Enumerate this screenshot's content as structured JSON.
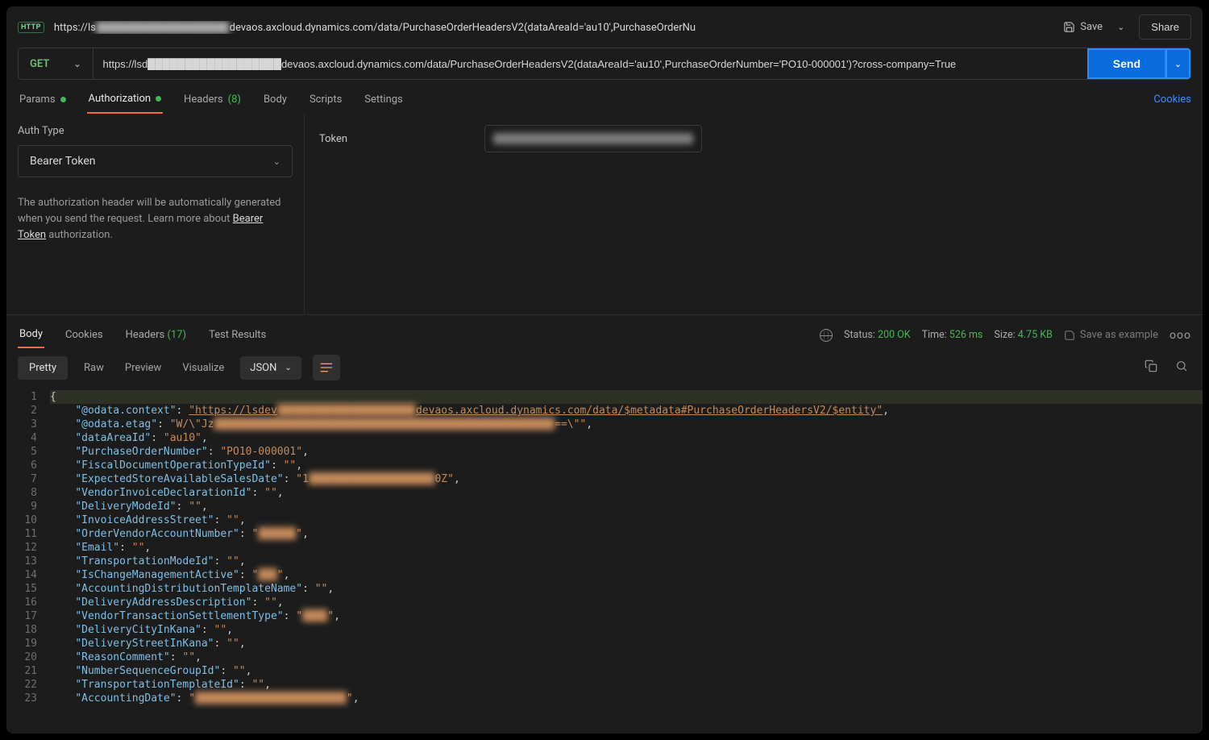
{
  "header": {
    "http_badge": "HTTP",
    "title_prefix": "https://ls",
    "title_blur": "██████████████████",
    "title_suffix": "devaos.axcloud.dynamics.com/data/PurchaseOrderHeadersV2(dataAreaId='au10',PurchaseOrderNu",
    "save_label": "Save",
    "share_label": "Share"
  },
  "request": {
    "method": "GET",
    "url": "https://lsd██████████████████devaos.axcloud.dynamics.com/data/PurchaseOrderHeadersV2(dataAreaId='au10',PurchaseOrderNumber='PO10-000001')?cross-company=True",
    "send_label": "Send"
  },
  "req_tabs": {
    "params": "Params",
    "authorization": "Authorization",
    "headers": "Headers",
    "headers_count": "(8)",
    "body": "Body",
    "scripts": "Scripts",
    "settings": "Settings",
    "cookies": "Cookies"
  },
  "auth": {
    "type_label": "Auth Type",
    "type_value": "Bearer Token",
    "help_1": "The authorization header will be automatically generated when you send the request. Learn more about ",
    "help_link": "Bearer Token",
    "help_2": " authorization.",
    "token_label": "Token"
  },
  "res_tabs": {
    "body": "Body",
    "cookies": "Cookies",
    "headers": "Headers",
    "headers_count": "(17)",
    "test_results": "Test Results"
  },
  "res_meta": {
    "status_label": "Status:",
    "status_value": "200 OK",
    "time_label": "Time:",
    "time_value": "526 ms",
    "size_label": "Size:",
    "size_value": "4.75 KB",
    "save_example": "Save as example"
  },
  "view": {
    "pretty": "Pretty",
    "raw": "Raw",
    "preview": "Preview",
    "visualize": "Visualize",
    "json": "JSON"
  },
  "response_body": {
    "lines": [
      {
        "raw": "{"
      },
      {
        "indent": 2,
        "key": "@odata.context",
        "value_prefix": "https://lsdev",
        "value_blur": "██████████████████████",
        "value_suffix": "devaos.axcloud.dynamics.com/data/$metadata#PurchaseOrderHeadersV2/$entity",
        "url": true,
        "comma": true
      },
      {
        "indent": 2,
        "key": "@odata.etag",
        "value_prefix": "W/\\\"Jz",
        "value_blur": "██████████████████████████████████████████████████████",
        "value_suffix": "==\\\"",
        "comma": true
      },
      {
        "indent": 2,
        "key": "dataAreaId",
        "value": "au10",
        "comma": true
      },
      {
        "indent": 2,
        "key": "PurchaseOrderNumber",
        "value": "PO10-000001",
        "comma": true
      },
      {
        "indent": 2,
        "key": "FiscalDocumentOperationTypeId",
        "value": "",
        "comma": true
      },
      {
        "indent": 2,
        "key": "ExpectedStoreAvailableSalesDate",
        "value_prefix": "1",
        "value_blur": "████████████████████",
        "value_suffix": "0Z",
        "comma": true
      },
      {
        "indent": 2,
        "key": "VendorInvoiceDeclarationId",
        "value": "",
        "comma": true
      },
      {
        "indent": 2,
        "key": "DeliveryModeId",
        "value": "",
        "comma": true
      },
      {
        "indent": 2,
        "key": "InvoiceAddressStreet",
        "value": "",
        "comma": true
      },
      {
        "indent": 2,
        "key": "OrderVendorAccountNumber",
        "value_prefix": "",
        "value_blur": "██████",
        "value_suffix": "",
        "comma": true
      },
      {
        "indent": 2,
        "key": "Email",
        "value": "",
        "comma": true
      },
      {
        "indent": 2,
        "key": "TransportationModeId",
        "value": "",
        "comma": true
      },
      {
        "indent": 2,
        "key": "IsChangeManagementActive",
        "value_prefix": "",
        "value_blur": "███",
        "value_suffix": "",
        "comma": true
      },
      {
        "indent": 2,
        "key": "AccountingDistributionTemplateName",
        "value": "",
        "comma": true
      },
      {
        "indent": 2,
        "key": "DeliveryAddressDescription",
        "value": "",
        "comma": true
      },
      {
        "indent": 2,
        "key": "VendorTransactionSettlementType",
        "value_prefix": "",
        "value_blur": "████",
        "value_suffix": "",
        "comma": true
      },
      {
        "indent": 2,
        "key": "DeliveryCityInKana",
        "value": "",
        "comma": true
      },
      {
        "indent": 2,
        "key": "DeliveryStreetInKana",
        "value": "",
        "comma": true
      },
      {
        "indent": 2,
        "key": "ReasonComment",
        "value": "",
        "comma": true
      },
      {
        "indent": 2,
        "key": "NumberSequenceGroupId",
        "value": "",
        "comma": true
      },
      {
        "indent": 2,
        "key": "TransportationTemplateId",
        "value": "",
        "comma": true
      },
      {
        "indent": 2,
        "key": "AccountingDate",
        "value_prefix": "",
        "value_blur": "████████████████████████",
        "value_suffix": "",
        "comma": true
      }
    ]
  }
}
